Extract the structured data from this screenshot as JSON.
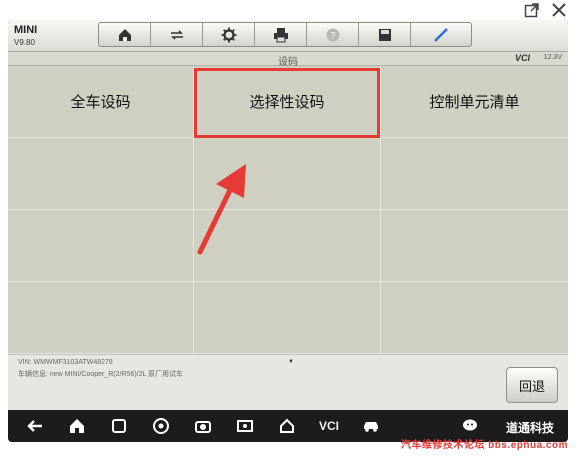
{
  "window": {
    "external_icon": "open-external-icon",
    "close_icon": "close-icon"
  },
  "header": {
    "car_name": "MINI",
    "version": "V9.80",
    "toolbar": [
      {
        "name": "home-icon"
      },
      {
        "name": "vehicle-swap-icon"
      },
      {
        "name": "settings-icon"
      },
      {
        "name": "print-icon"
      },
      {
        "name": "help-icon"
      },
      {
        "name": "save-icon"
      },
      {
        "name": "pen-icon"
      }
    ]
  },
  "status": {
    "title": "设码",
    "vci": "VCI",
    "battery": "12.3V"
  },
  "menu": {
    "items": [
      "全车设码",
      "选择性设码",
      "控制单元清单",
      "",
      "",
      "",
      "",
      "",
      "",
      "",
      "",
      ""
    ],
    "selected_index": 1
  },
  "info": {
    "vin": "VIN: WMWMF3103ATW48278",
    "car_info": "车辆信息: new MINI/Cooper_R(2/R56)/2L 原厂用试车",
    "back_label": "回退"
  },
  "navbar": {
    "vcl_label": "VCI",
    "brand": "道通科技"
  },
  "watermark": "汽车维修技术论坛 bbs.ephua.com",
  "colors": {
    "highlight": "#e53a36",
    "grid_bg": "#cfd0c2"
  }
}
